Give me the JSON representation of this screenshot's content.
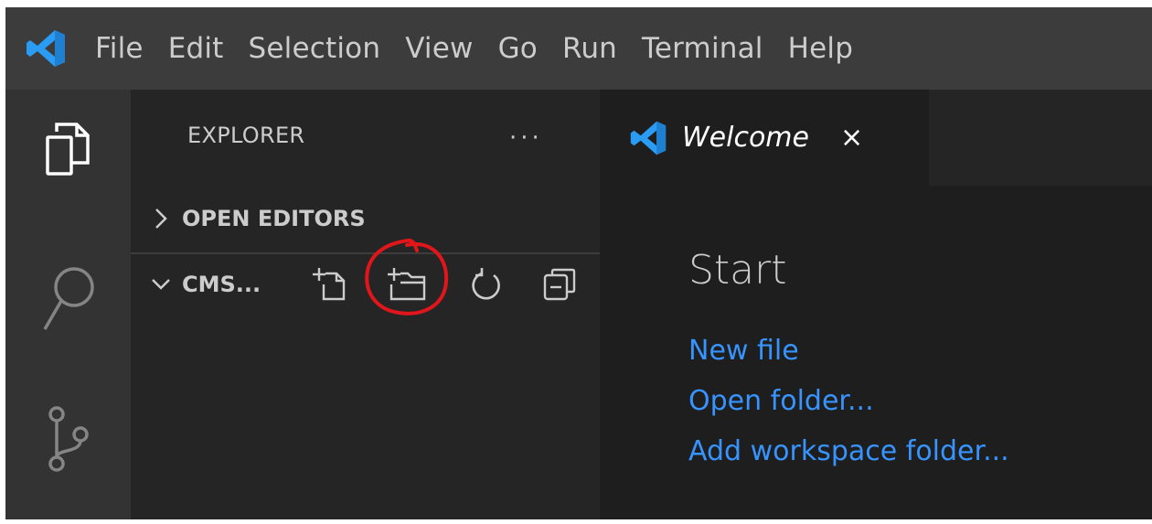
{
  "menu": {
    "items": [
      "File",
      "Edit",
      "Selection",
      "View",
      "Go",
      "Run",
      "Terminal",
      "Help"
    ]
  },
  "activity": {
    "icons": [
      "explorer-icon",
      "search-icon",
      "source-control-icon"
    ]
  },
  "sidebar": {
    "title": "EXPLORER",
    "more_label": "···",
    "open_editors_label": "OPEN EDITORS",
    "folder_label": "CMS...",
    "toolbar_icons": [
      "new-file-icon",
      "new-folder-icon",
      "refresh-icon",
      "collapse-all-icon"
    ]
  },
  "editor": {
    "tab_label": "Welcome",
    "tab_close": "×",
    "start_heading": "Start",
    "links": [
      "New file",
      "Open folder...",
      "Add workspace folder..."
    ]
  },
  "colors": {
    "titlebar": "#3c3c3c",
    "activitybar": "#333333",
    "sidebar": "#252526",
    "editor": "#1e1e1e",
    "link": "#3794ff",
    "logo": "#2a9cf4",
    "annotation": "#e0161b"
  }
}
